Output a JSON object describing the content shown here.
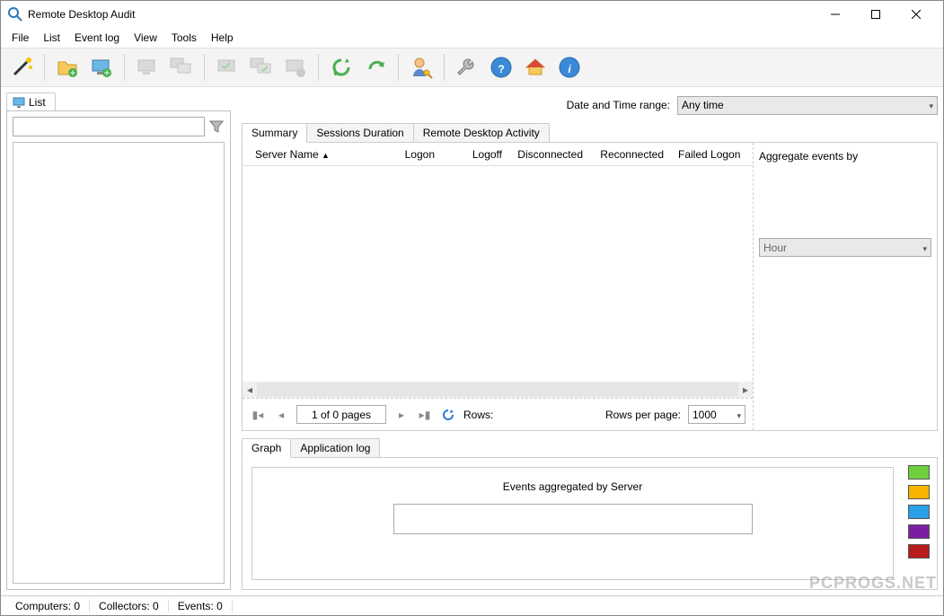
{
  "window": {
    "title": "Remote Desktop Audit"
  },
  "menu": {
    "items": [
      "File",
      "List",
      "Event log",
      "View",
      "Tools",
      "Help"
    ]
  },
  "toolbar_icons": [
    "wizard",
    "folder-add",
    "computer-add",
    "computer",
    "computer-group",
    "check1",
    "check2",
    "check3",
    "refresh-green",
    "refresh-arrow",
    "user-key",
    "wrench",
    "help",
    "home",
    "info"
  ],
  "left": {
    "tab_label": "List",
    "search_placeholder": ""
  },
  "date_range": {
    "label": "Date and Time range:",
    "value": "Any time"
  },
  "summary_tabs": {
    "items": [
      "Summary",
      "Sessions Duration",
      "Remote Desktop Activity"
    ],
    "active": 0
  },
  "columns": {
    "server": "Server Name",
    "logon": "Logon",
    "logoff": "Logoff",
    "disc": "Disconnected",
    "recon": "Reconnected",
    "fail": "Failed Logon"
  },
  "aggregate": {
    "label": "Aggregate events by",
    "value": "Hour"
  },
  "pager": {
    "page_text": "1 of 0 pages",
    "rows_label": "Rows:",
    "rpp_label": "Rows per page:",
    "rpp_value": "1000"
  },
  "bottom_tabs": {
    "items": [
      "Graph",
      "Application log"
    ],
    "active": 0
  },
  "graph": {
    "title": "Events aggregated by Server"
  },
  "legend_colors": [
    "#6fcf3f",
    "#f6b400",
    "#2aa0e8",
    "#7b1fa2",
    "#b71c1c"
  ],
  "statusbar": {
    "computers": "Computers: 0",
    "collectors": "Collectors: 0",
    "events": "Events: 0"
  },
  "watermark": "PCPROGS.NET"
}
